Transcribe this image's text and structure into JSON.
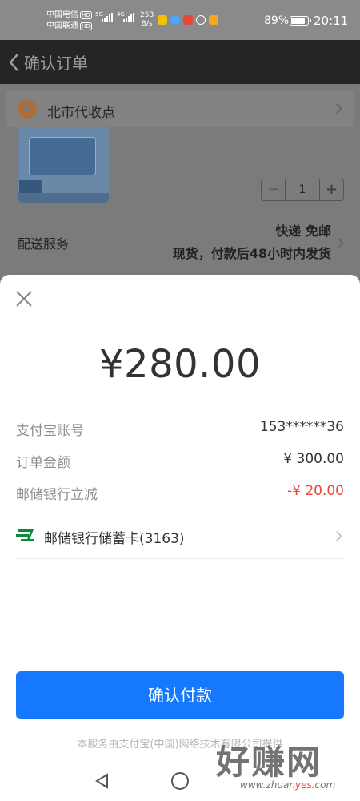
{
  "status_bar": {
    "carrier1": "中国电信",
    "carrier2": "中国联通",
    "hd": "HD",
    "net1": "5G",
    "net2": "4G",
    "speed_value": "253",
    "speed_unit": "B/s",
    "battery": "89%",
    "time": "20:11"
  },
  "header": {
    "title": "确认订单"
  },
  "background_page": {
    "location": "北市代收点",
    "quantity": "1",
    "minus": "−",
    "plus": "+",
    "delivery_label": "配送服务",
    "delivery_line1": "快递 免邮",
    "delivery_line2": "现货，付款后48小时内发货"
  },
  "payment_sheet": {
    "amount": "¥280.00",
    "rows": [
      {
        "label": "支付宝账号",
        "value": "153******36"
      },
      {
        "label": "订单金额",
        "value": "¥ 300.00"
      },
      {
        "label": "邮储银行立减",
        "value": "-¥ 20.00"
      }
    ],
    "payment_method": "邮储银行储蓄卡(3163)",
    "confirm_button": "确认付款",
    "footer_note": "本服务由支付宝(中国)网络技术有限公司提供"
  },
  "watermark": {
    "text": "好赚网",
    "url_prefix": "www.zhuan",
    "url_highlight": "yes",
    "url_suffix": ".com"
  },
  "colors": {
    "accent": "#1677ff",
    "discount": "#e8483b"
  }
}
